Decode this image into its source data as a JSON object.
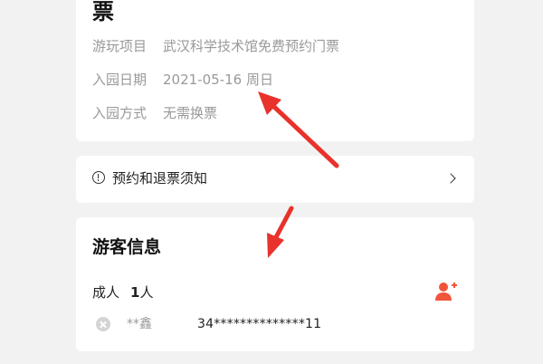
{
  "ticket": {
    "title_partial": "票",
    "rows": [
      {
        "label": "游玩项目",
        "value": "武汉科学技术馆免费预约门票"
      },
      {
        "label": "入园日期",
        "value": "2021-05-16 周日"
      },
      {
        "label": "入园方式",
        "value": "无需换票"
      }
    ]
  },
  "notice": {
    "icon": "info-circle-icon",
    "label": "预约和退票须知",
    "chevron": "chevron-right-icon"
  },
  "visitors": {
    "title": "游客信息",
    "type_label": "成人",
    "count": "1",
    "count_unit": "人",
    "add_icon": "add-person-icon",
    "entries": [
      {
        "name": "**鑫",
        "id_number": "34**************11"
      }
    ]
  },
  "colors": {
    "accent": "#f0553a",
    "annotation_arrow": "#e8322b",
    "background": "#f2f2f2"
  }
}
